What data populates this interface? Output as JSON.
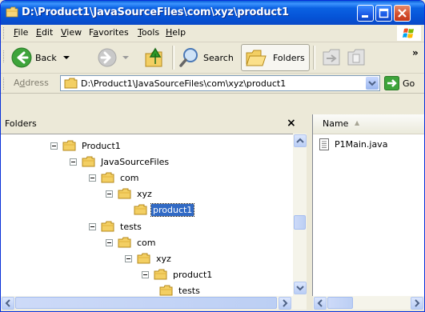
{
  "window": {
    "title": "D:\\Product1\\JavaSourceFiles\\com\\xyz\\product1",
    "minimize_label": "",
    "maximize_label": "",
    "close_label": ""
  },
  "menu": {
    "items": [
      "File",
      "Edit",
      "View",
      "Favorites",
      "Tools",
      "Help"
    ]
  },
  "toolbar": {
    "back_label": "Back",
    "search_label": "Search",
    "folders_label": "Folders",
    "more_label": "»"
  },
  "address": {
    "label": "Address",
    "value": "D:\\Product1\\JavaSourceFiles\\com\\xyz\\product1",
    "go_label": "Go"
  },
  "folders_pane": {
    "title": "Folders",
    "close_label": "×",
    "tree": [
      {
        "label": "Product1",
        "expander": true,
        "selected": false
      },
      {
        "label": "JavaSourceFiles",
        "expander": true,
        "selected": false
      },
      {
        "label": "com",
        "expander": true,
        "selected": false
      },
      {
        "label": "xyz",
        "expander": true,
        "selected": false
      },
      {
        "label": "product1",
        "expander": false,
        "selected": true
      },
      {
        "label": "tests",
        "expander": true,
        "selected": false
      },
      {
        "label": "com",
        "expander": true,
        "selected": false
      },
      {
        "label": "xyz",
        "expander": true,
        "selected": false
      },
      {
        "label": "product1",
        "expander": true,
        "selected": false
      },
      {
        "label": "tests",
        "expander": false,
        "selected": false
      }
    ]
  },
  "file_list": {
    "column_name": "Name",
    "sort_indicator": "▲",
    "files": [
      {
        "name": "P1Main.java",
        "icon": "text-file-icon"
      }
    ]
  },
  "colors": {
    "titlebar": "#0b62e3",
    "selection": "#316ac5",
    "chrome": "#ece9d8"
  }
}
